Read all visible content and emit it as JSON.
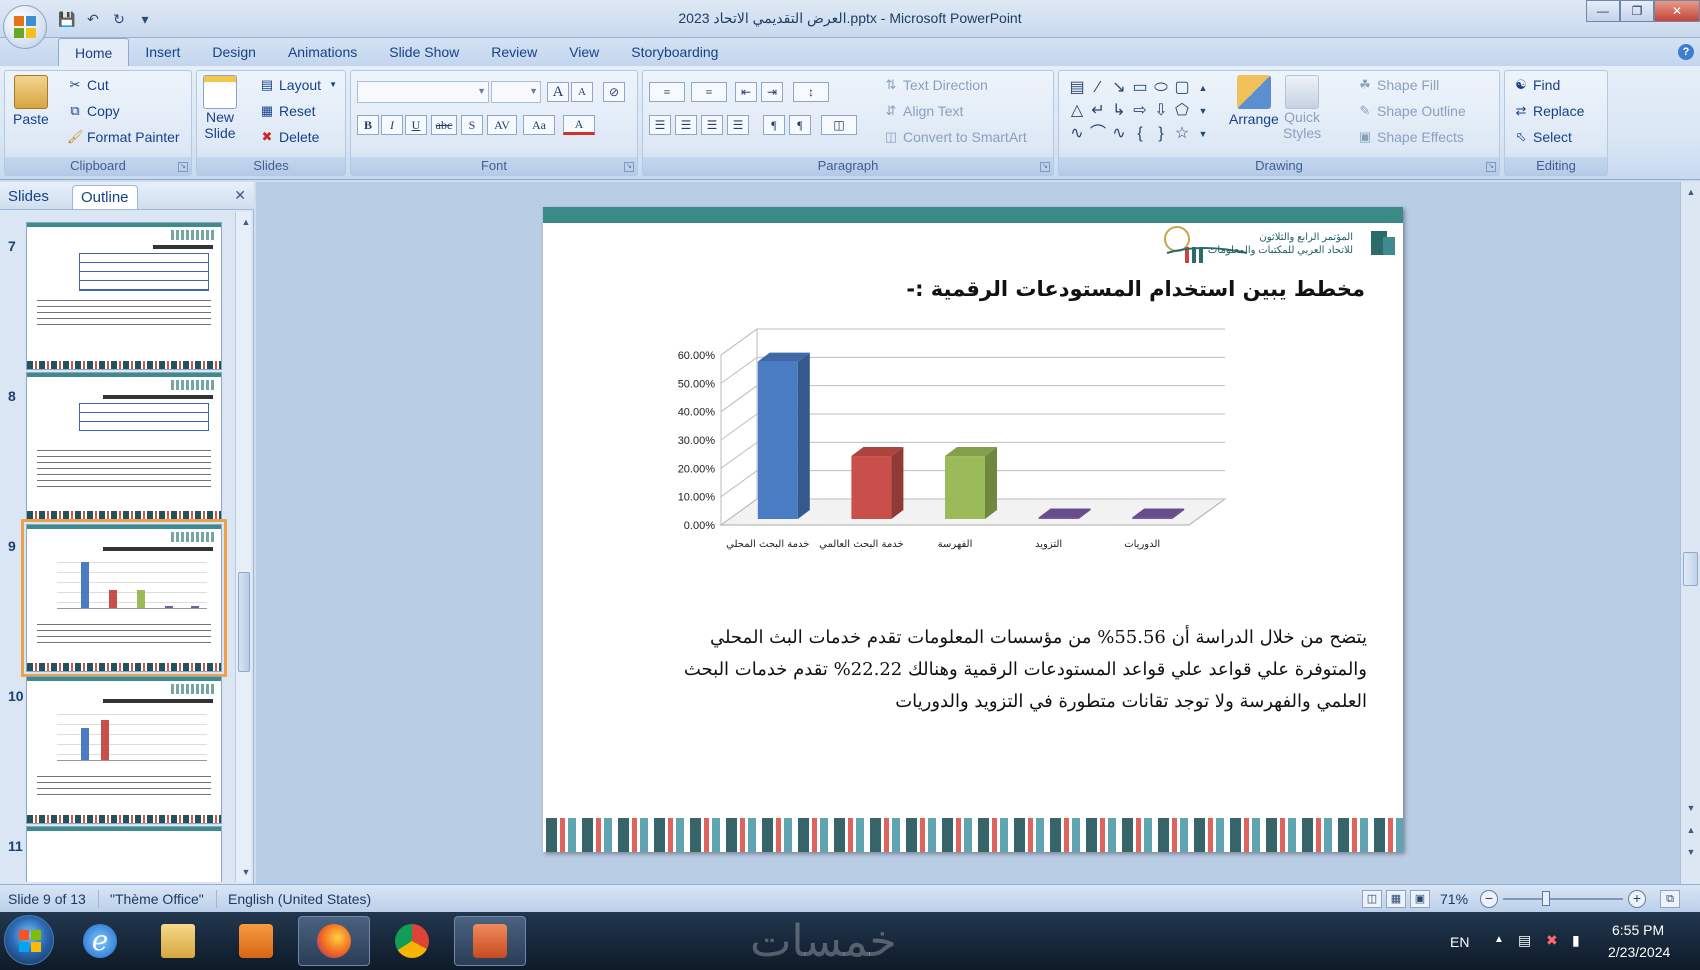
{
  "window": {
    "title": "العرض التقديمي الاتحاد 2023.pptx - Microsoft PowerPoint"
  },
  "ribbon": {
    "tabs": [
      "Home",
      "Insert",
      "Design",
      "Animations",
      "Slide Show",
      "Review",
      "View",
      "Storyboarding"
    ],
    "active_tab": "Home",
    "clipboard": {
      "paste": "Paste",
      "cut": "Cut",
      "copy": "Copy",
      "format_painter": "Format Painter",
      "label": "Clipboard"
    },
    "slides": {
      "new_slide": "New",
      "new_slide_2": "Slide",
      "layout": "Layout",
      "reset": "Reset",
      "delete": "Delete",
      "label": "Slides"
    },
    "font": {
      "label": "Font",
      "bold": "B",
      "italic": "I",
      "underline": "U",
      "strike": "abc",
      "shadow": "S",
      "spacing": "AV",
      "case": "Aa",
      "color": "A",
      "grow": "A",
      "shrink": "A"
    },
    "paragraph": {
      "label": "Paragraph",
      "text_direction": "Text Direction",
      "align_text": "Align Text",
      "convert_smartart": "Convert to SmartArt"
    },
    "drawing": {
      "label": "Drawing",
      "arrange": "Arrange",
      "quick_styles": "Quick",
      "quick_styles_2": "Styles",
      "shape_fill": "Shape Fill",
      "shape_outline": "Shape Outline",
      "shape_effects": "Shape Effects"
    },
    "editing": {
      "label": "Editing",
      "find": "Find",
      "replace": "Replace",
      "select": "Select"
    }
  },
  "left_pane": {
    "tabs": [
      "Slides",
      "Outline"
    ],
    "thumbnails": [
      {
        "number": "7"
      },
      {
        "number": "8"
      },
      {
        "number": "9"
      },
      {
        "number": "10"
      },
      {
        "number": "11"
      }
    ]
  },
  "slide": {
    "logo_text_line1": "المؤتمر الرابع والثلاثون",
    "logo_text_line2": "للاتحاد العربي للمكتبات والمعلومات",
    "title": "مخطط يبين استخدام المستودعات الرقمية :-",
    "paragraph": "يتضح من خلال الدراسة أن 55.56% من مؤسسات المعلومات تقدم خدمات البث المحلي والمتوفرة علي قواعد علي قواعد المستودعات الرقمية وهنالك 22.22% تقدم خدمات البحث العلمي والفهرسة ولا توجد تقانات متطورة في التزويد والدوريات"
  },
  "chart_data": {
    "type": "bar",
    "categories": [
      "خدمة البحث المحلي",
      "خدمة البحث العالمي",
      "الفهرسة",
      "التزويد",
      "الدوريات"
    ],
    "values": [
      55.56,
      22.22,
      22.22,
      0,
      0
    ],
    "colors": [
      "#4a7cc4",
      "#c9504a",
      "#9bbb59",
      "#7a5aa6",
      "#7a5aa6"
    ],
    "yticks": [
      "0.00%",
      "10.00%",
      "20.00%",
      "30.00%",
      "40.00%",
      "50.00%",
      "60.00%"
    ],
    "ylim": [
      0,
      60
    ],
    "grid": true,
    "style": "3d-column"
  },
  "status": {
    "slide_of": "Slide 9 of 13",
    "theme": "\"Thème Office\"",
    "language": "English (United States)",
    "zoom": "71%"
  },
  "taskbar": {
    "lang": "EN",
    "time": "6:55 PM",
    "date": "2/23/2024",
    "watermark": "خمسات"
  }
}
